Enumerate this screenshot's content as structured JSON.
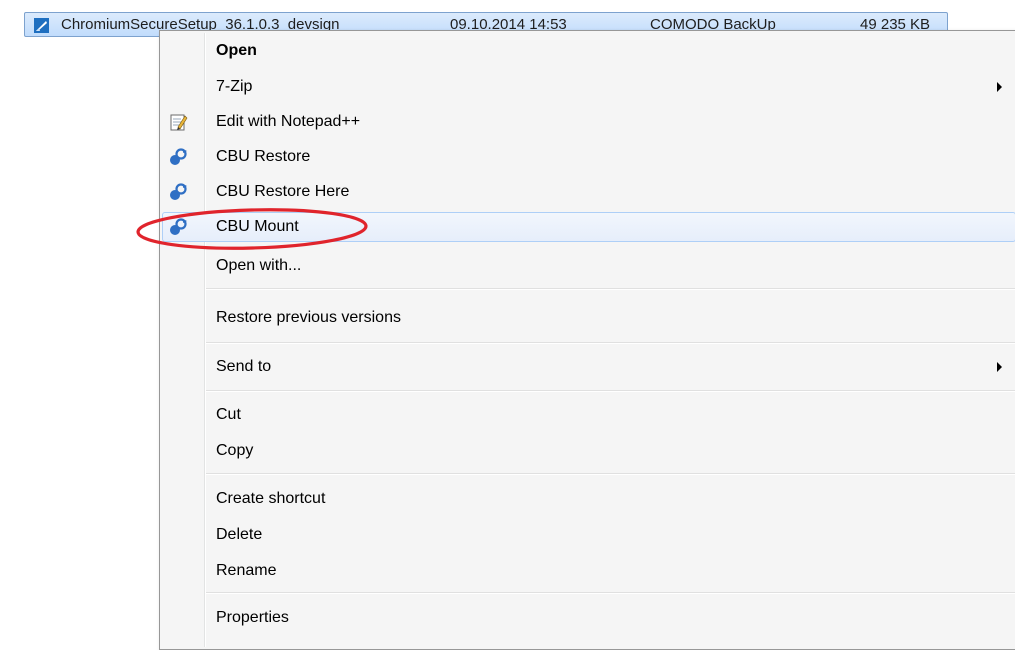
{
  "file_row": {
    "name": "ChromiumSecureSetup_36.1.0.3_devsign",
    "date_modified": "09.10.2014 14:53",
    "type": "COMODO BackUp",
    "size": "49 235 KB",
    "icon": "cbu-file-icon"
  },
  "context_menu": {
    "items": [
      {
        "label": "Open",
        "bold": true
      },
      {
        "label": "7-Zip",
        "submenu": true
      },
      {
        "label": "Edit with Notepad++",
        "icon": "notepad-plus-icon"
      },
      {
        "label": "CBU Restore",
        "icon": "cbu-icon"
      },
      {
        "label": "CBU Restore Here",
        "icon": "cbu-icon"
      },
      {
        "label": "CBU Mount",
        "icon": "cbu-icon",
        "highlighted": true
      },
      {
        "label": "Open with..."
      },
      {
        "label": "Restore previous versions"
      },
      {
        "label": "Send to",
        "submenu": true
      },
      {
        "label": "Cut"
      },
      {
        "label": "Copy"
      },
      {
        "label": "Create shortcut"
      },
      {
        "label": "Delete"
      },
      {
        "label": "Rename"
      },
      {
        "label": "Properties"
      }
    ]
  },
  "annotation": {
    "color": "#e0242c",
    "target": "CBU Mount"
  },
  "colors": {
    "selection_border": "#7da2ce",
    "hover_border": "#aecff7",
    "menu_background": "#f5f5f5"
  }
}
